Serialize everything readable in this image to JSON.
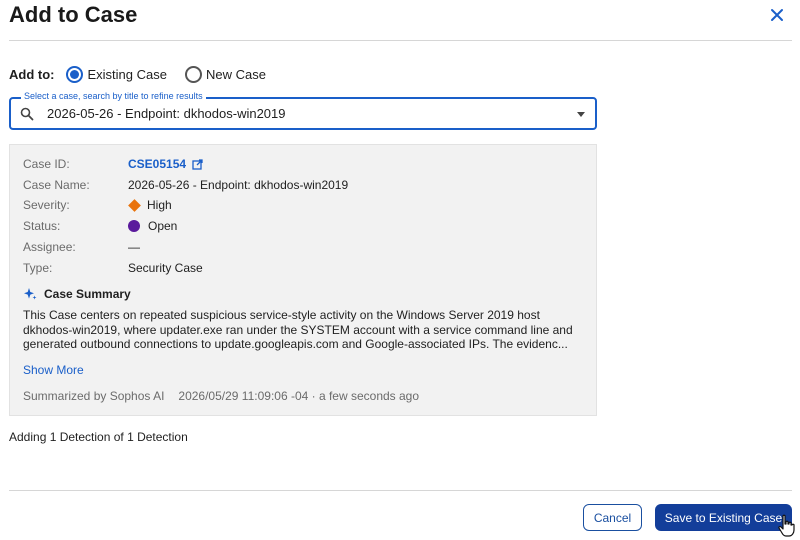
{
  "dialog": {
    "title": "Add to Case",
    "close_icon": "close-icon"
  },
  "add_to": {
    "label": "Add to:",
    "options": [
      {
        "label": "Existing Case",
        "selected": true
      },
      {
        "label": "New Case",
        "selected": false
      }
    ]
  },
  "case_select": {
    "legend": "Select a case, search by title to refine results",
    "value": "2026-05-26 - Endpoint: dkhodos-win2019",
    "icon": "search-icon"
  },
  "case_details": {
    "rows": [
      {
        "key": "Case ID:",
        "value": "CSE05154"
      },
      {
        "key": "Case Name:",
        "value": "2026-05-26 - Endpoint: dkhodos-win2019"
      },
      {
        "key": "Severity:",
        "value": "High"
      },
      {
        "key": "Status:",
        "value": "Open"
      },
      {
        "key": "Assignee:",
        "value": "—"
      },
      {
        "key": "Type:",
        "value": "Security Case"
      }
    ],
    "severity_color": "#e9730c",
    "status_color": "#5a1a9c"
  },
  "summary": {
    "heading": "Case Summary",
    "text": "This Case centers on repeated suspicious service-style activity on the Windows Server 2019 host dkhodos-win2019, where updater.exe ran under the SYSTEM account with a service command line and generated outbound connections to update.googleapis.com and Google-associated IPs. The evidenc...",
    "show_more": "Show More",
    "summarized_by": "Summarized by Sophos AI",
    "timestamp": "2026/05/29 11:09:06 -04 · a few seconds ago"
  },
  "footer": {
    "adding_text": "Adding 1 Detection of 1 Detection",
    "cancel_label": "Cancel",
    "save_label": "Save to Existing Case"
  },
  "colors": {
    "accent": "#1a5fc9",
    "primary_button": "#133e9a"
  }
}
